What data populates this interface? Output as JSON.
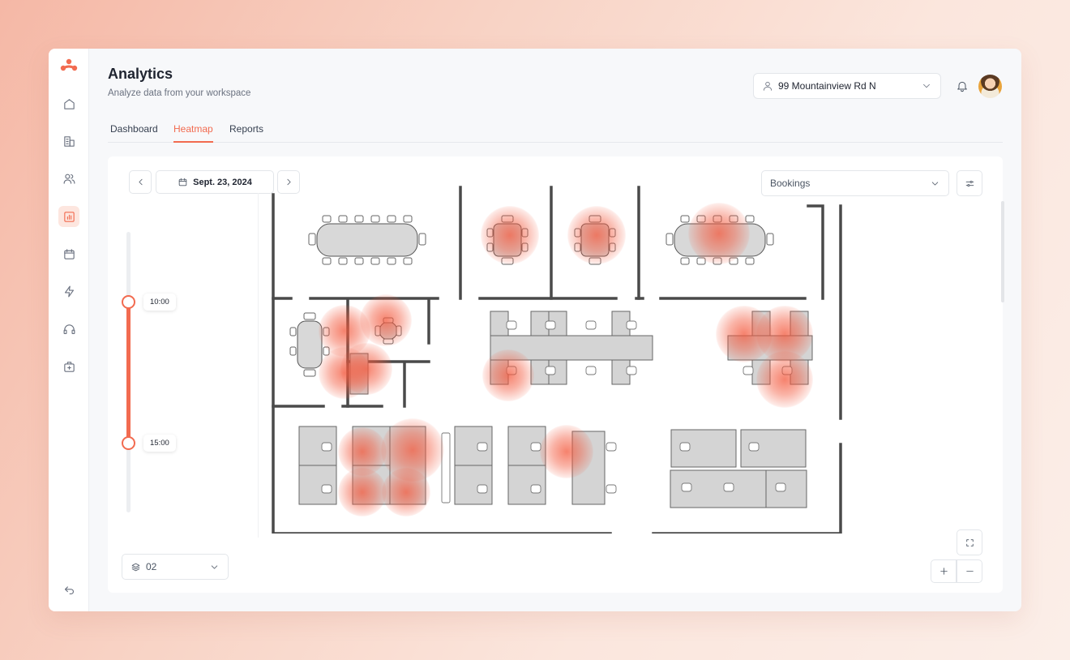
{
  "header": {
    "title": "Analytics",
    "subtitle": "Analyze data from your workspace",
    "location": "99 Mountainview Rd N"
  },
  "tabs": [
    {
      "label": "Dashboard",
      "active": false
    },
    {
      "label": "Heatmap",
      "active": true
    },
    {
      "label": "Reports",
      "active": false
    }
  ],
  "sidebar": {
    "items": [
      {
        "icon": "home-icon",
        "active": false
      },
      {
        "icon": "building-icon",
        "active": false
      },
      {
        "icon": "users-icon",
        "active": false
      },
      {
        "icon": "analytics-icon",
        "active": true
      },
      {
        "icon": "calendar-icon",
        "active": false
      },
      {
        "icon": "lightning-icon",
        "active": false
      },
      {
        "icon": "headset-icon",
        "active": false
      },
      {
        "icon": "medical-kit-icon",
        "active": false
      }
    ],
    "bottom_icon": "logout-icon"
  },
  "toolbar": {
    "date": "Sept. 23, 2024",
    "metric": "Bookings"
  },
  "time_range": {
    "start": "10:00",
    "end": "15:00"
  },
  "floor": {
    "selected": "02"
  },
  "colors": {
    "accent": "#f26b50",
    "heat": "#f3583c"
  }
}
